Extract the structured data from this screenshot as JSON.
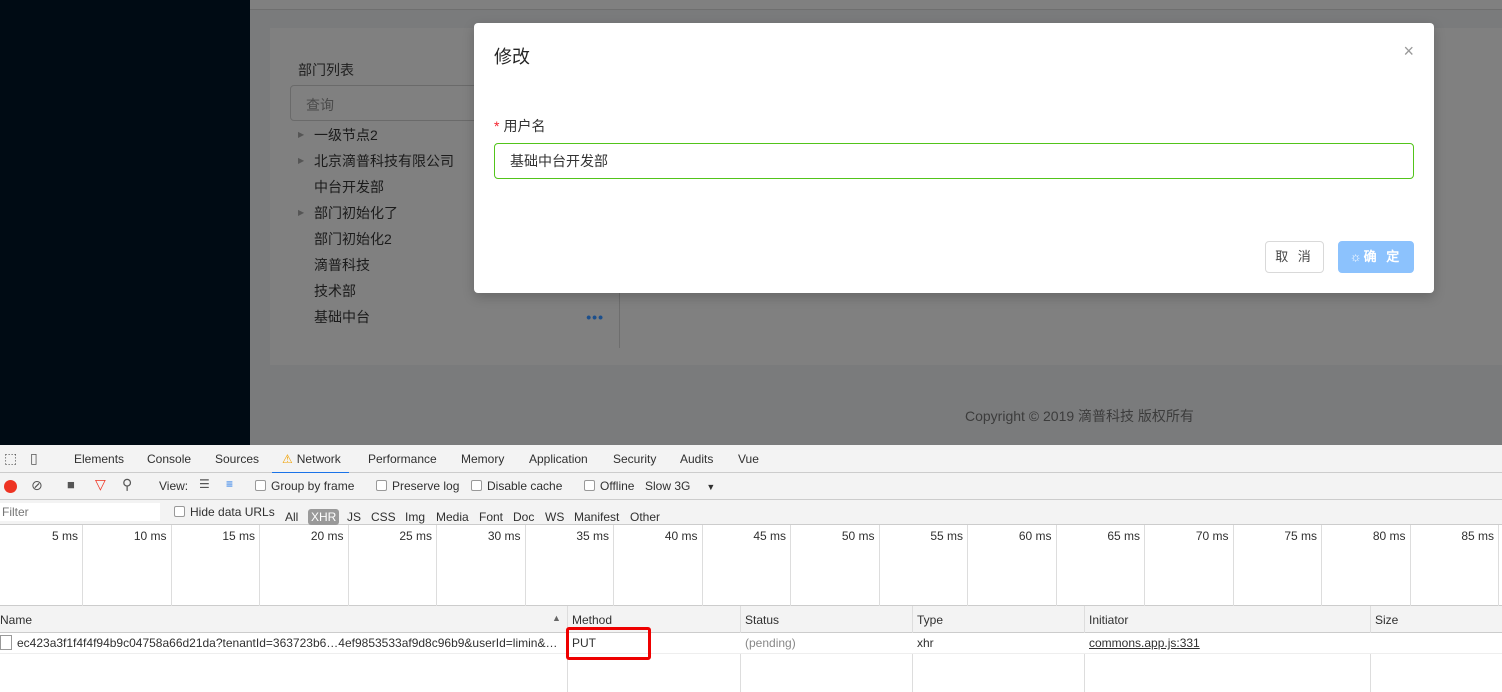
{
  "app": {
    "tree_title": "部门列表",
    "search_placeholder": "查询",
    "tree": [
      {
        "label": "一级节点2",
        "expandable": true
      },
      {
        "label": "北京滴普科技有限公司",
        "expandable": true
      },
      {
        "label": "中台开发部",
        "expandable": false
      },
      {
        "label": "部门初始化了",
        "expandable": true
      },
      {
        "label": "部门初始化2",
        "expandable": false
      },
      {
        "label": "滴普科技",
        "expandable": false
      },
      {
        "label": "技术部",
        "expandable": false
      },
      {
        "label": "基础中台",
        "expandable": false
      }
    ],
    "more": "•••",
    "copyright": "Copyright © 2019 滴普科技 版权所有"
  },
  "modal": {
    "title": "修改",
    "close": "×",
    "field_label": "用户名",
    "required": "*",
    "field_value": "基础中台开发部",
    "cancel": "取 消",
    "ok": "确 定",
    "ok_spinner": "☼"
  },
  "devtools": {
    "tabs": [
      "Elements",
      "Console",
      "Sources",
      "Network",
      "Performance",
      "Memory",
      "Application",
      "Security",
      "Audits",
      "Vue"
    ],
    "warning": "⚠",
    "toolbar": {
      "view": "View:",
      "group_by_frame": "Group by frame",
      "preserve_log": "Preserve log",
      "disable_cache": "Disable cache",
      "offline": "Offline",
      "throttle": "Slow 3G"
    },
    "filter": {
      "placeholder": "Filter",
      "hide_data_urls": "Hide data URLs",
      "types": [
        "All",
        "XHR",
        "JS",
        "CSS",
        "Img",
        "Media",
        "Font",
        "Doc",
        "WS",
        "Manifest",
        "Other"
      ]
    },
    "ticks": [
      "5 ms",
      "10 ms",
      "15 ms",
      "20 ms",
      "25 ms",
      "30 ms",
      "35 ms",
      "40 ms",
      "45 ms",
      "50 ms",
      "55 ms",
      "60 ms",
      "65 ms",
      "70 ms",
      "75 ms",
      "80 ms",
      "85 ms"
    ],
    "columns": [
      "Name",
      "Method",
      "Status",
      "Type",
      "Initiator",
      "Size"
    ],
    "row": {
      "name": "ec423a3f1f4f4f94b9c04758a66d21da?tenantId=363723b6…4ef9853533af9d8c96b9&userId=limin&…",
      "method": "PUT",
      "status": "(pending)",
      "type": "xhr",
      "initiator": "commons.app.js:331",
      "size": ""
    }
  }
}
